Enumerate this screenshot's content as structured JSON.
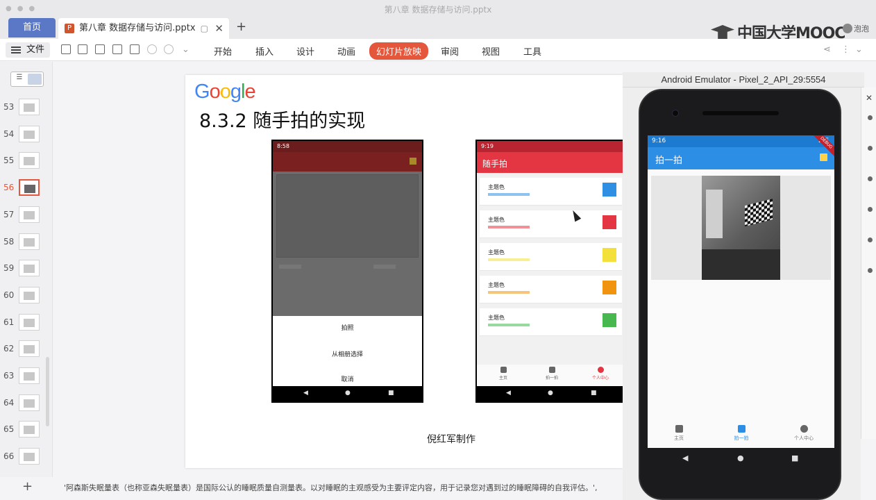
{
  "window_title": "第八章 数据存储与访问.pptx",
  "tabs": {
    "home": "首页",
    "doc": "第八章 数据存储与访问.pptx",
    "doc_icon": "P",
    "close": "✕",
    "monitor": "▢",
    "add": "+"
  },
  "watermark": {
    "brand": "中国大学MOOC",
    "user": "泡泡"
  },
  "ribbon": {
    "file": "文件",
    "menus": [
      "开始",
      "插入",
      "设计",
      "动画",
      "幻灯片放映",
      "审阅",
      "视图",
      "工具"
    ],
    "active_menu": "幻灯片放映",
    "active_color": "#e4573c"
  },
  "thumbnails": {
    "numbers": [
      "53",
      "54",
      "55",
      "56",
      "57",
      "58",
      "59",
      "60",
      "61",
      "62",
      "63",
      "64",
      "65",
      "66"
    ],
    "current": "56"
  },
  "slide": {
    "logo_letters": [
      "G",
      "o",
      "o",
      "g",
      "l",
      "e"
    ],
    "logo_colors": [
      "#4285f4",
      "#ea4335",
      "#fbbc05",
      "#4285f4",
      "#34a853",
      "#ea4335"
    ],
    "title": "8.3.2 随手拍的实现",
    "author": "倪红军制作",
    "phone_a": {
      "time": "8:58",
      "sheet_options": [
        "拍照",
        "从相册选择",
        "取消"
      ]
    },
    "phone_b": {
      "time": "9:19",
      "app_title": "随手拍",
      "rows": [
        {
          "label": "主题色",
          "color": "#2f8fe3"
        },
        {
          "label": "主题色",
          "color": "#e33542"
        },
        {
          "label": "主题色",
          "color": "#f3e03a"
        },
        {
          "label": "主题色",
          "color": "#f0930e"
        },
        {
          "label": "主题色",
          "color": "#46b84e"
        }
      ],
      "tabs": [
        "主页",
        "拍一拍",
        "个人中心"
      ]
    }
  },
  "emulator": {
    "title": "Android Emulator - Pixel_2_API_29:5554",
    "time": "9:16",
    "signal": "LTE",
    "debug_ribbon": "DEBUG",
    "app_title": "拍一拍",
    "tabs": [
      "主页",
      "拍一拍",
      "个人中心"
    ],
    "active_tab": "拍一拍",
    "close": "✕"
  },
  "nav_icons": {
    "back": "◀",
    "home": "●",
    "recent": "■"
  },
  "notes": "'阿森斯失眠量表（也称亚森失眠量表）是国际公认的睡眠质量自测量表。以对睡眠的主观感受为主要评定内容，用于记录您对遇到过的睡眠障碍的自我评估。',"
}
